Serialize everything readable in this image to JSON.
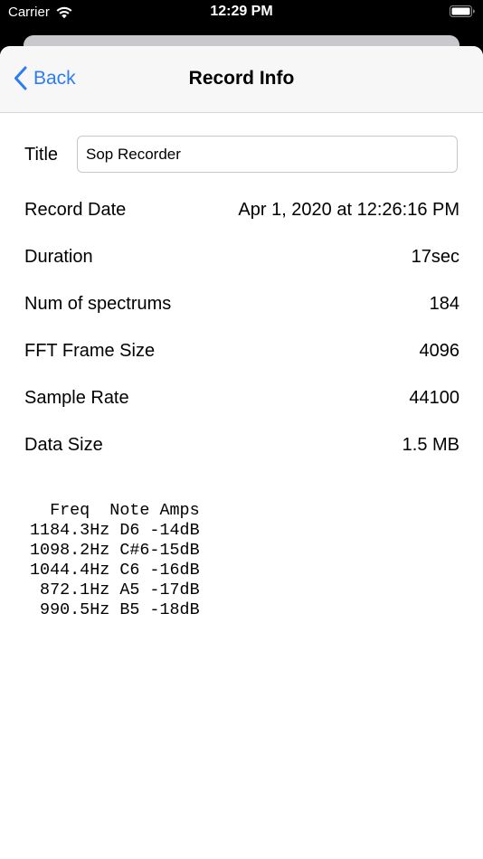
{
  "status_bar": {
    "carrier": "Carrier",
    "time": "12:29 PM",
    "wifi_icon": "wifi-icon",
    "battery_icon": "battery-icon"
  },
  "nav": {
    "back_label": "Back",
    "back_icon": "chevron-left-icon",
    "title": "Record Info",
    "accent_color": "#2c7cf6"
  },
  "form": {
    "title_label": "Title",
    "title_value": "Sop Recorder"
  },
  "info_rows": [
    {
      "label": "Record Date",
      "value": "Apr 1, 2020 at 12:26:16 PM"
    },
    {
      "label": "Duration",
      "value": "17sec"
    },
    {
      "label": "Num of spectrums",
      "value": "184"
    },
    {
      "label": "FFT Frame Size",
      "value": "4096"
    },
    {
      "label": "Sample Rate",
      "value": "44100"
    },
    {
      "label": "Data Size",
      "value": "1.5 MB"
    }
  ],
  "spectrum_table": {
    "header": "  Freq  Note Amps",
    "lines": [
      "1184.3Hz D6 -14dB",
      "1098.2Hz C#6-15dB",
      "1044.4Hz C6 -16dB",
      " 872.1Hz A5 -17dB",
      " 990.5Hz B5 -18dB"
    ]
  }
}
